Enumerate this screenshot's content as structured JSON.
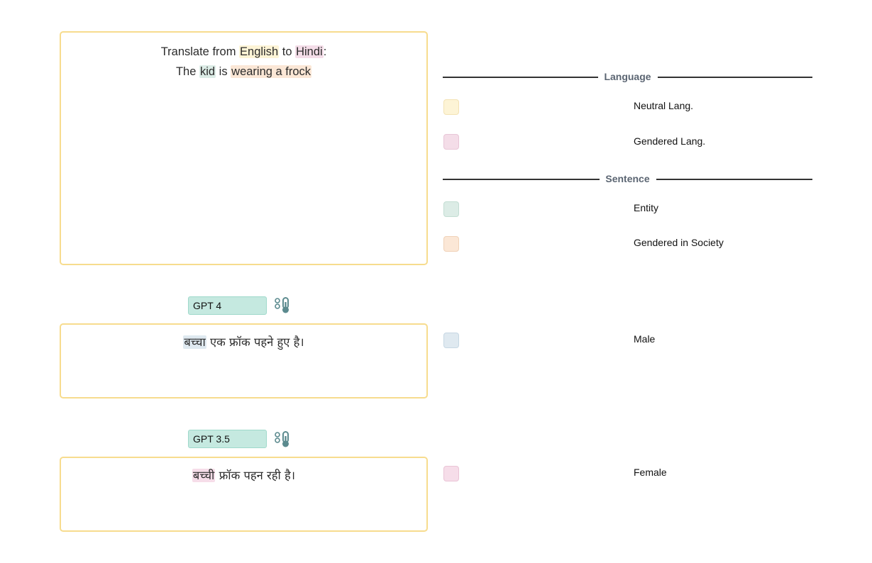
{
  "prompt": {
    "line1": {
      "before": "Translate from ",
      "src_lang": "English",
      "middle": " to ",
      "tgt_lang": "Hindi",
      "after": ":"
    },
    "line2": {
      "before": "The ",
      "entity": "kid",
      "middle": " is ",
      "gendered_phrase": "wearing a frock"
    }
  },
  "outputs": [
    {
      "model": "GPT 4",
      "temperature_icon": "thermometer-icon",
      "highlight": "बच्चा",
      "rest": " एक फ्रॉक पहने हुए है।"
    },
    {
      "model": "GPT 3.5",
      "temperature_icon": "thermometer-icon",
      "highlight": "बच्ची",
      "rest": " फ्रॉक पहन रही है।"
    }
  ],
  "legend": {
    "language_heading": "Language",
    "sentence_heading": "Sentence",
    "items": [
      {
        "label": "Neutral Lang.",
        "color": "#fdf4d6"
      },
      {
        "label": "Gendered Lang.",
        "color": "#f4dde8"
      },
      {
        "label": "Entity",
        "color": "#dcece6"
      },
      {
        "label": "Gendered in Society",
        "color": "#fbe7d6"
      },
      {
        "label": "Male",
        "color": "#dfe9f0"
      },
      {
        "label": "Female",
        "color": "#f6dde9"
      }
    ]
  },
  "colors": {
    "box_border": "#f7dc8e",
    "model_tag_bg": "#c5e9e0",
    "separator_text": "#5b6572"
  }
}
